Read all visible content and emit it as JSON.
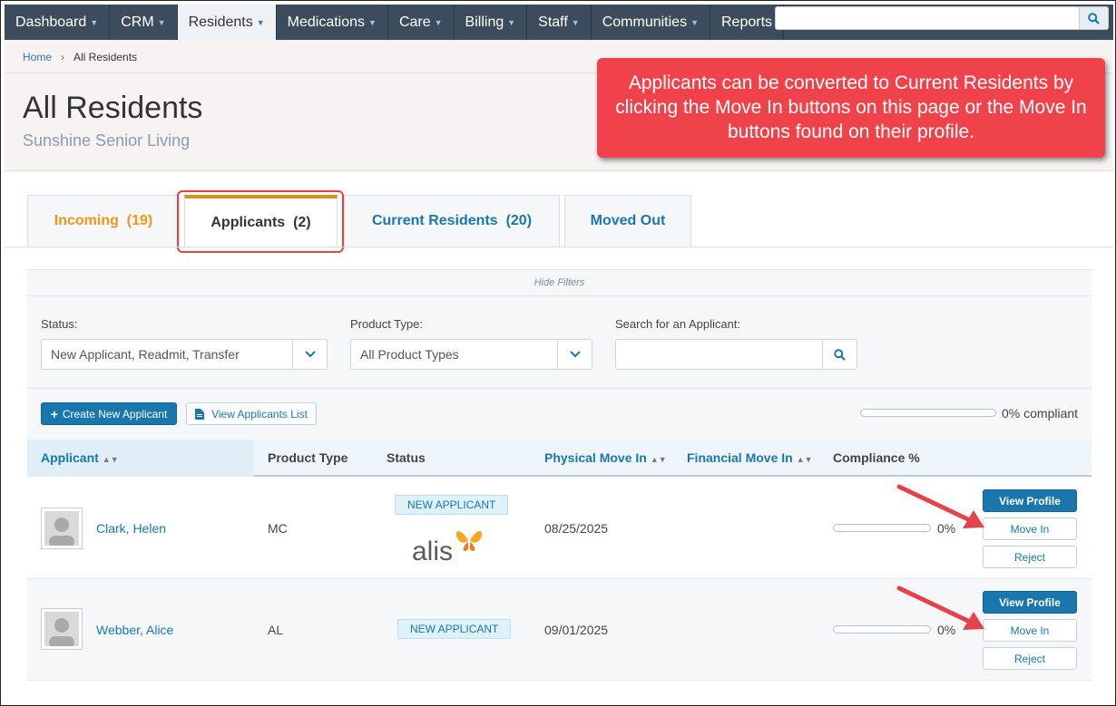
{
  "nav": {
    "items": [
      {
        "label": "Dashboard",
        "dropdown": true
      },
      {
        "label": "CRM",
        "dropdown": true
      },
      {
        "label": "Residents",
        "dropdown": true,
        "active": true
      },
      {
        "label": "Medications",
        "dropdown": true
      },
      {
        "label": "Care",
        "dropdown": true
      },
      {
        "label": "Billing",
        "dropdown": true
      },
      {
        "label": "Staff",
        "dropdown": true
      },
      {
        "label": "Communities",
        "dropdown": true
      },
      {
        "label": "Reports",
        "dropdown": false
      }
    ],
    "search_placeholder": ""
  },
  "breadcrumb": {
    "home": "Home",
    "current": "All Residents"
  },
  "page": {
    "title": "All Residents",
    "subtitle": "Sunshine Senior Living"
  },
  "callout": {
    "text": "Applicants can be converted to Current Residents by clicking the Move In buttons on this page or the Move In buttons found on their profile."
  },
  "tabs": [
    {
      "label": "Incoming",
      "count": "(19)"
    },
    {
      "label": "Applicants",
      "count": "(2)",
      "active": true
    },
    {
      "label": "Current Residents",
      "count": "(20)"
    },
    {
      "label": "Moved Out",
      "count": ""
    }
  ],
  "filters": {
    "hide_label": "Hide Filters",
    "status_label": "Status:",
    "status_value": "New Applicant, Readmit, Transfer",
    "product_label": "Product Type:",
    "product_value": "All Product Types",
    "search_label": "Search for an Applicant:",
    "search_value": ""
  },
  "actions": {
    "create_label": "Create New Applicant",
    "list_label": "View Applicants List",
    "overall_compliance": 0,
    "compliance_text": "0% compliant"
  },
  "table": {
    "headers": [
      "Applicant",
      "Product Type",
      "Status",
      "Physical Move In",
      "Financial Move In",
      "Compliance %"
    ],
    "rows": [
      {
        "name": "Clark, Helen",
        "product": "MC",
        "status": "NEW APPLICANT",
        "physical_move_in": "08/25/2025",
        "financial_move_in": "",
        "compliance": 0,
        "compliance_text": "0%"
      },
      {
        "name": "Webber, Alice",
        "product": "AL",
        "status": "NEW APPLICANT",
        "physical_move_in": "09/01/2025",
        "financial_move_in": "",
        "compliance": 0,
        "compliance_text": "0%"
      }
    ],
    "row_actions": {
      "view": "View Profile",
      "move_in": "Move In",
      "reject": "Reject"
    }
  },
  "watermark": {
    "text": "alis"
  },
  "colors": {
    "nav_bg": "#3d4c5c",
    "accent_blue": "#1a77ad",
    "incoming_orange": "#f0961e",
    "callout_red": "#f0424a",
    "annotation_red": "#e3434a"
  }
}
